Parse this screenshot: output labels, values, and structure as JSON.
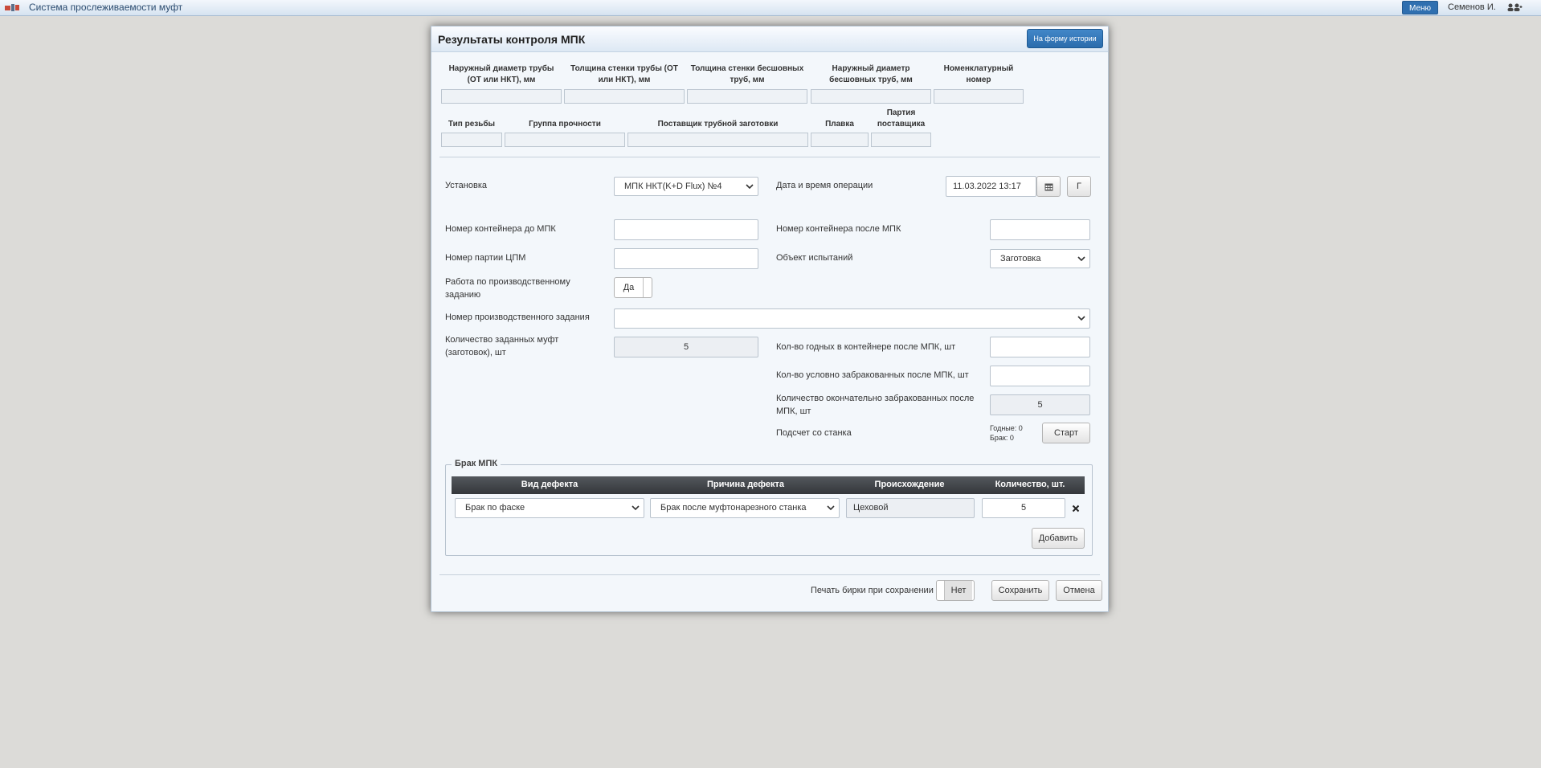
{
  "topbar": {
    "app_title": "Система прослеживаемости муфт",
    "menu_label": "Меню",
    "user_name": "Семенов И."
  },
  "modal": {
    "title": "Результаты контроля МПК",
    "history_button": "На форму истории",
    "header_fields_row1": [
      {
        "label": "Наружный диаметр трубы (ОТ или НКТ), мм",
        "value": ""
      },
      {
        "label": "Толщина стенки трубы (ОТ или НКТ), мм",
        "value": ""
      },
      {
        "label": "Толщина стенки бесшовных труб, мм",
        "value": ""
      },
      {
        "label": "Наружный диаметр бесшовных труб, мм",
        "value": ""
      },
      {
        "label": "Номенклатурный номер",
        "value": ""
      }
    ],
    "header_fields_row2": [
      {
        "label": "Тип резьбы",
        "value": ""
      },
      {
        "label": "Группа прочности",
        "value": ""
      },
      {
        "label": "Поставщик трубной заготовки",
        "value": ""
      },
      {
        "label": "Плавка",
        "value": ""
      },
      {
        "label": "Партия поставщика",
        "value": ""
      }
    ],
    "form": {
      "installation_label": "Установка",
      "installation_value": "МПК НКТ(K+D Flux) №4",
      "datetime_label": "Дата и время операции",
      "datetime_value": "11.03.2022 13:17",
      "datetime_extra_btn": "Г",
      "container_before_label": "Номер контейнера до МПК",
      "container_before_value": "",
      "container_after_label": "Номер контейнера после МПК",
      "container_after_value": "",
      "batch_cpm_label": "Номер партии ЦПМ",
      "batch_cpm_value": "",
      "test_object_label": "Объект испытаний",
      "test_object_value": "Заготовка",
      "production_task_work_label": "Работа по производственному заданию",
      "production_task_work_value": "Да",
      "production_task_number_label": "Номер производственного задания",
      "production_task_number_value": "",
      "planned_qty_label": "Количество заданных муфт (заготовок), шт",
      "planned_qty_value": "5",
      "good_qty_label": "Кол-во годных в контейнере после МПК, шт",
      "good_qty_value": "",
      "cond_reject_label": "Кол-во условно забракованных после МПК, шт",
      "cond_reject_value": "",
      "final_reject_label": "Количество окончательно забракованных после МПК, шт",
      "final_reject_value": "5",
      "machine_count_label": "Подсчет со станка",
      "machine_good_text": "Годные: 0",
      "machine_reject_text": "Брак: 0",
      "start_button": "Старт"
    },
    "defects": {
      "legend": "Брак МПК",
      "columns": [
        "Вид дефекта",
        "Причина дефекта",
        "Происхождение",
        "Количество, шт."
      ],
      "rows": [
        {
          "type": "Брак по фаске",
          "reason": "Брак после муфтонарезного станка",
          "origin": "Цеховой",
          "qty": "5"
        }
      ],
      "add_button": "Добавить"
    },
    "footer": {
      "print_label": "Печать бирки при сохранении",
      "print_value": "Нет",
      "save_button": "Сохранить",
      "cancel_button": "Отмена"
    }
  }
}
